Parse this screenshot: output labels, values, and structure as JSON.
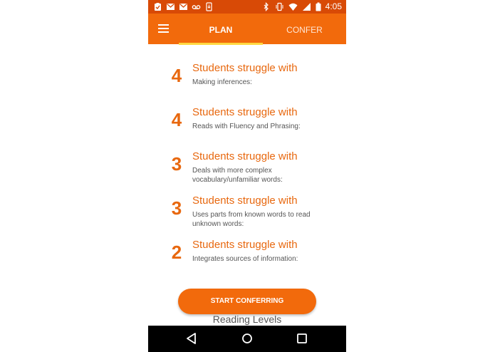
{
  "status_bar": {
    "time": "4:05",
    "left_icons": [
      "clipboard-check-icon",
      "gmail-icon",
      "gmail-icon",
      "voicemail-icon",
      "phone-download-icon"
    ],
    "right_icons": [
      "bluetooth-icon",
      "vibrate-icon",
      "wifi-icon",
      "signal-icon",
      "battery-icon"
    ]
  },
  "app_bar": {
    "tabs": [
      {
        "label": "PLAN",
        "selected": true
      },
      {
        "label": "CONFER",
        "selected": false
      }
    ]
  },
  "struggles": [
    {
      "count": "4",
      "title": "Students struggle with",
      "skill": "Making inferences:"
    },
    {
      "count": "4",
      "title": "Students struggle with",
      "skill": "Reads with Fluency and Phrasing:"
    },
    {
      "count": "3",
      "title": "Students struggle with",
      "skill": "Deals with more complex vocabulary/unfamiliar words:"
    },
    {
      "count": "3",
      "title": "Students struggle with",
      "skill": "Uses parts from known words to read unknown words:"
    },
    {
      "count": "2",
      "title": "Students struggle with",
      "skill": "Integrates sources of information:"
    }
  ],
  "cta": {
    "label": "START CONFERRING"
  },
  "footer": {
    "reading_levels": "Reading Levels"
  },
  "colors": {
    "status_bar": "#d84a06",
    "app_bar": "#f26a0c",
    "accent": "#e8680f",
    "tab_indicator": "#ffd740"
  }
}
